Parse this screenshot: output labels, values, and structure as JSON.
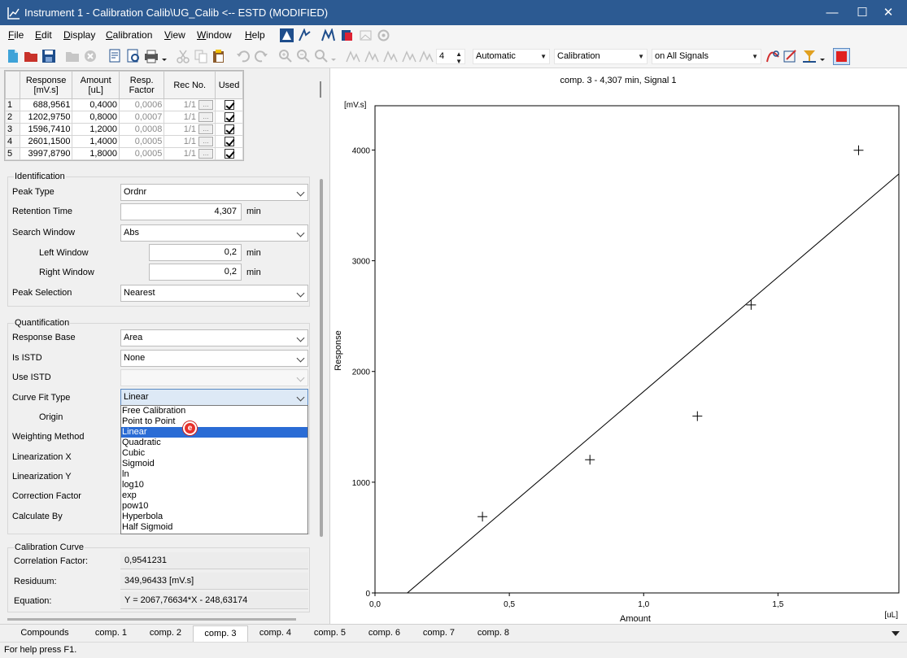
{
  "window": {
    "title": "Instrument 1 - Calibration Calib\\UG_Calib <-- ESTD (MODIFIED)",
    "minimize": "—",
    "maximize": "☐",
    "close": "✕"
  },
  "menu": [
    {
      "label": "File",
      "key": "F",
      "rest": "ile"
    },
    {
      "label": "Edit",
      "key": "E",
      "rest": "dit"
    },
    {
      "label": "Display",
      "key": "D",
      "rest": "isplay"
    },
    {
      "label": "Calibration",
      "key": "C",
      "rest": "alibration"
    },
    {
      "label": "View",
      "key": "V",
      "rest": "iew"
    },
    {
      "label": "Window",
      "key": "W",
      "rest": "indow"
    },
    {
      "label": "Help",
      "key": "H",
      "rest": "elp"
    }
  ],
  "toolbar": {
    "level_value": "4",
    "mode_select": "Automatic",
    "type_select": "Calibration",
    "signal_select": "on All Signals"
  },
  "calib_table": {
    "headers": [
      "Response\n[mV.s]",
      "Amount\n[uL]",
      "Resp.\nFactor",
      "Rec No.",
      "Used"
    ],
    "rows": [
      {
        "n": "1",
        "response": "688,9561",
        "amount": "0,4000",
        "factor": "0,0006",
        "rec": "1/1"
      },
      {
        "n": "2",
        "response": "1202,9750",
        "amount": "0,8000",
        "factor": "0,0007",
        "rec": "1/1"
      },
      {
        "n": "3",
        "response": "1596,7410",
        "amount": "1,2000",
        "factor": "0,0008",
        "rec": "1/1"
      },
      {
        "n": "4",
        "response": "2601,1500",
        "amount": "1,4000",
        "factor": "0,0005",
        "rec": "1/1"
      },
      {
        "n": "5",
        "response": "3997,8790",
        "amount": "1,8000",
        "factor": "0,0005",
        "rec": "1/1"
      }
    ],
    "ellipsis": "..."
  },
  "identification": {
    "title": "Identification",
    "peak_type_label": "Peak Type",
    "peak_type": "Ordnr",
    "retention_label": "Retention Time",
    "retention": "4,307",
    "retention_unit": "min",
    "search_window_label": "Search Window",
    "search_window": "Abs",
    "left_window_label": "Left Window",
    "left_window": "0,2",
    "left_unit": "min",
    "right_window_label": "Right Window",
    "right_window": "0,2",
    "right_unit": "min",
    "peak_selection_label": "Peak Selection",
    "peak_selection": "Nearest"
  },
  "quantification": {
    "title": "Quantification",
    "response_base_label": "Response Base",
    "response_base": "Area",
    "is_istd_label": "Is ISTD",
    "is_istd": "None",
    "use_istd_label": "Use ISTD",
    "use_istd": "",
    "curve_fit_label": "Curve Fit Type",
    "curve_fit": "Linear",
    "origin_label": "Origin",
    "weighting_label": "Weighting Method",
    "lin_x_label": "Linearization X",
    "lin_y_label": "Linearization Y",
    "correction_label": "Correction Factor",
    "calculate_label": "Calculate By",
    "options": [
      "Free Calibration",
      "Point to Point",
      "Linear",
      "Quadratic",
      "Cubic",
      "Sigmoid",
      "ln",
      "log10",
      "exp",
      "pow10",
      "Hyperbola",
      "Half Sigmoid"
    ],
    "selected_option": "Linear"
  },
  "cursor_badge": "e",
  "calibration_curve": {
    "title": "Calibration Curve",
    "correlation_label": "Correlation Factor:",
    "correlation": "0,9541231",
    "residuum_label": "Residuum:",
    "residuum": "349,96433 [mV.s]",
    "equation_label": "Equation:",
    "equation": "Y = 2067,76634*X - 248,63174"
  },
  "chart_data": {
    "type": "scatter",
    "title": "comp. 3 - 4,307 min, Signal 1",
    "xlabel": "Amount",
    "ylabel": "Response",
    "x_unit": "[uL]",
    "y_unit": "[mV.s]",
    "xlim": [
      0,
      1.95
    ],
    "ylim": [
      0,
      4400
    ],
    "x_ticks": [
      {
        "v": 0,
        "label": "0,0"
      },
      {
        "v": 0.5,
        "label": "0,5"
      },
      {
        "v": 1.0,
        "label": "1,0"
      },
      {
        "v": 1.5,
        "label": "1,5"
      }
    ],
    "y_ticks": [
      {
        "v": 0,
        "label": "0"
      },
      {
        "v": 1000,
        "label": "1000"
      },
      {
        "v": 2000,
        "label": "2000"
      },
      {
        "v": 3000,
        "label": "3000"
      },
      {
        "v": 4000,
        "label": "4000"
      }
    ],
    "points": [
      {
        "x": 0.4,
        "y": 688.9561
      },
      {
        "x": 0.8,
        "y": 1202.975
      },
      {
        "x": 1.2,
        "y": 1596.741
      },
      {
        "x": 1.4,
        "y": 2601.15
      },
      {
        "x": 1.8,
        "y": 3997.879
      }
    ],
    "fit": {
      "slope": 2067.76634,
      "intercept": -248.63174
    },
    "grid": false
  },
  "tabs": [
    "Compounds",
    "comp. 1",
    "comp. 2",
    "comp. 3",
    "comp. 4",
    "comp. 5",
    "comp. 6",
    "comp. 7",
    "comp. 8"
  ],
  "active_tab": "comp. 3",
  "status": "For help press F1."
}
